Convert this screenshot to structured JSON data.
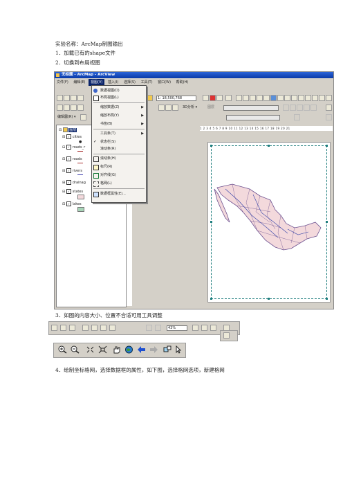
{
  "doc": {
    "line1": "实验名称：ArcMap制图输出",
    "line2": "1．加载已有的shape文件",
    "line3": "2．切换到布局视图",
    "line4": "3．如图的内容大小、位置不合适可用工具调整",
    "line5": "4．绘制坐标格网，选择数据框的属性，如下图，选择格网选项，新建格网"
  },
  "window": {
    "title": "无标题 - ArcMap - ArcView",
    "menus": [
      "文件(F)",
      "编辑(E)",
      "视图(V)",
      "插入(I)",
      "选择(S)",
      "工具(T)",
      "窗口(W)",
      "帮助(H)"
    ],
    "scale": "1: 18,500,768",
    "spatial_analyst": "3D分析 ▾",
    "layer_label": "图层",
    "editor": "编辑器(R) ▾",
    "toc_root": "图层",
    "layers": [
      "cities",
      "roads_r",
      "roads",
      "rivers",
      "drainag",
      "states",
      "lakes"
    ],
    "view_menu": [
      {
        "label": "数据视图(D)",
        "icon": "globe-icon"
      },
      {
        "label": "布局视图(L)",
        "icon": "layout-icon"
      },
      {
        "label": "缩放数据(Z)",
        "arrow": true
      },
      {
        "label": "缩放布局(Y)",
        "arrow": true
      },
      {
        "label": "书签(B)",
        "arrow": true
      },
      {
        "label": "工具条(T)",
        "arrow": true
      },
      {
        "label": "状态栏(S)",
        "check": true
      },
      {
        "label": "滚动条(R)"
      },
      {
        "label": "滚动条(H)",
        "icon": "scroll-icon"
      },
      {
        "label": "标尺(R)",
        "icon": "ruler-icon"
      },
      {
        "label": "对齐线(G)",
        "icon": "guide-icon"
      },
      {
        "label": "格网(L)",
        "icon": "grid-icon"
      },
      {
        "label": "数据框属性(E)...",
        "icon": "props-icon"
      }
    ],
    "ruler_numbers": "1 2 3 4 5 6 7 8 9 10 11 12 13 14 15 16 17 18 19 20 21"
  },
  "layout_toolbar": {
    "zoom": "43%"
  },
  "colors": {
    "title_blue": "#0a3aa8",
    "chrome": "#d4d0c8",
    "frame": "#1e7e7e",
    "map_fill": "#f3d9dc",
    "map_line": "#6b4f8f"
  }
}
